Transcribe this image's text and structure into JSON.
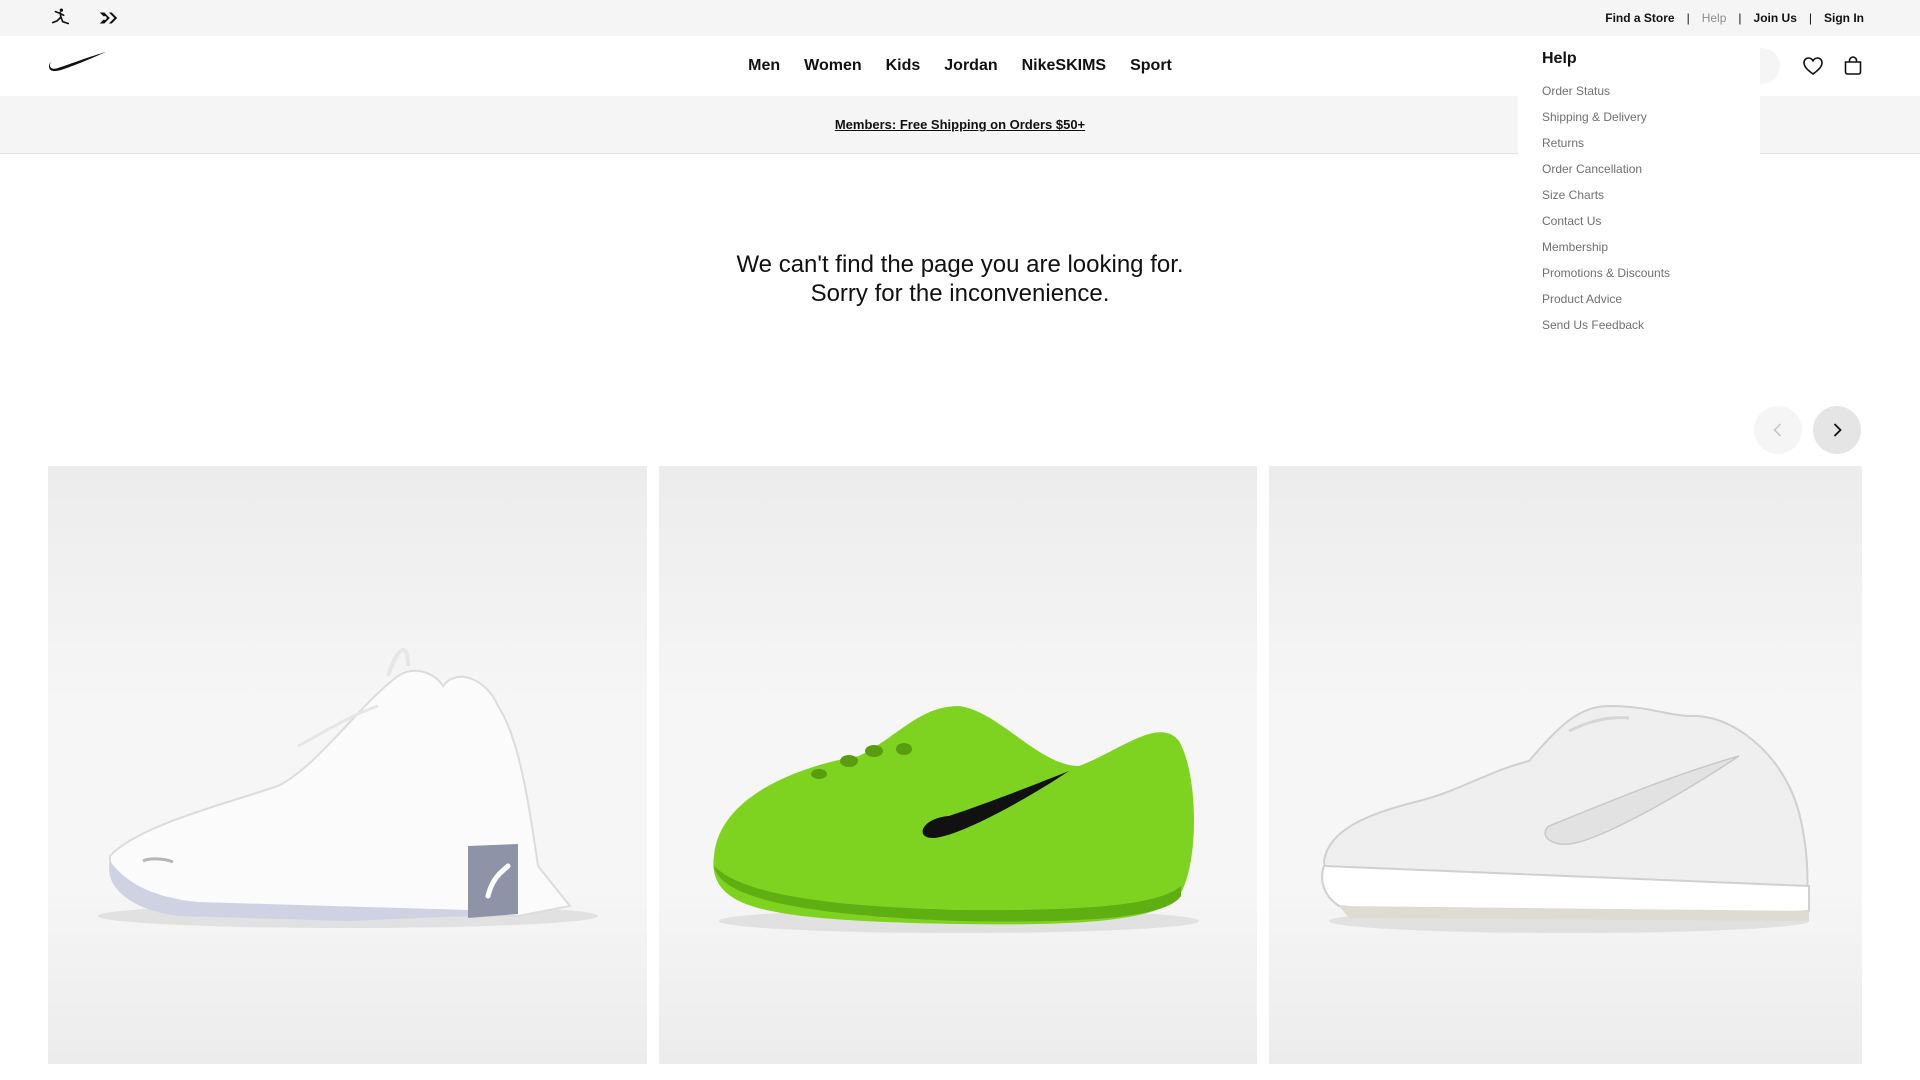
{
  "utility_bar": {
    "brand_icons": [
      "jordan-jumpman-icon",
      "converse-star-chevron-icon"
    ],
    "links": {
      "find_store": "Find a Store",
      "help": "Help",
      "join": "Join Us",
      "sign_in": "Sign In",
      "separator": "|"
    }
  },
  "header": {
    "logo": "nike-swoosh-icon",
    "nav": [
      "Men",
      "Women",
      "Kids",
      "Jordan",
      "NikeSKIMS",
      "Sport"
    ],
    "icons": [
      "heart-icon",
      "bag-icon"
    ]
  },
  "promo": {
    "text": "Members: Free Shipping on Orders $50+"
  },
  "error": {
    "line1": "We can't find the page you are looking for.",
    "line2": "Sorry for the inconvenience."
  },
  "help_menu": {
    "title": "Help",
    "items": [
      "Order Status",
      "Shipping & Delivery",
      "Returns",
      "Order Cancellation",
      "Size Charts",
      "Contact Us",
      "Membership",
      "Promotions & Discounts",
      "Product Advice",
      "Send Us Feedback"
    ]
  },
  "carousel": {
    "prev_icon": "chevron-left-icon",
    "next_icon": "chevron-right-icon",
    "products": [
      {
        "image": "white-training-shoe",
        "color": "#ffffff"
      },
      {
        "image": "volt-green-slip-on-shoe",
        "color": "#7ed321"
      },
      {
        "image": "white-low-top-sneaker",
        "color": "#eeeeee"
      }
    ]
  }
}
